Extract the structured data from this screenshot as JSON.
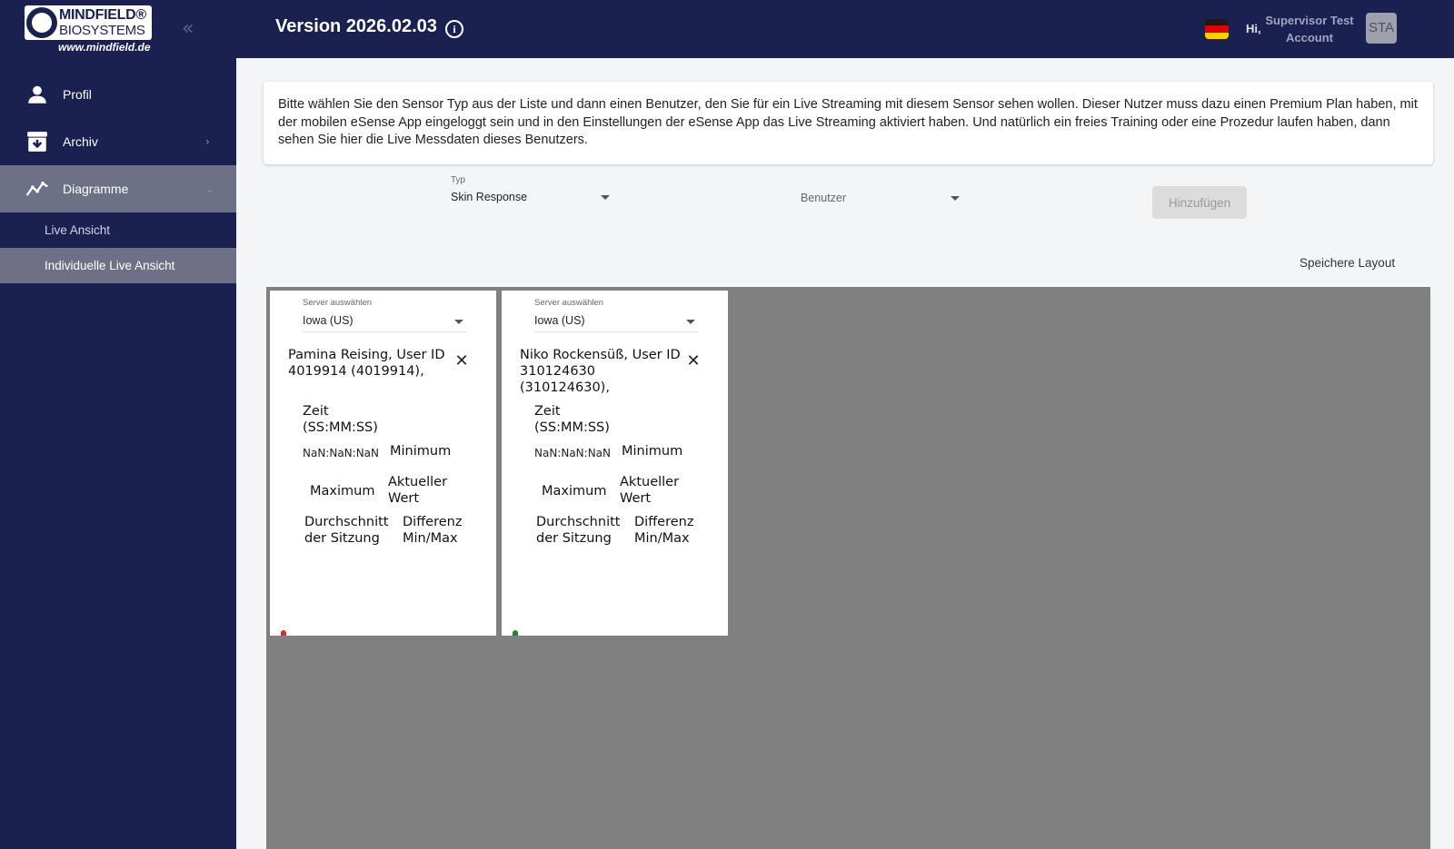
{
  "brand": {
    "line1": "MINDFIELD®",
    "line2": "BIOSYSTEMS",
    "url": "www.mindfield.de"
  },
  "sidebar": {
    "items": [
      {
        "label": "Profil",
        "icon": "person-icon"
      },
      {
        "label": "Archiv",
        "icon": "archive-icon"
      },
      {
        "label": "Diagramme",
        "icon": "chart-line-icon"
      }
    ],
    "sub_items": [
      {
        "label": "Live Ansicht"
      },
      {
        "label": "Individuelle Live Ansicht"
      }
    ]
  },
  "header": {
    "version": "Version 2026.02.03",
    "greeting": "Hi,",
    "user_line1": "Supervisor Test",
    "user_line2": "Account",
    "avatar_initials": "STA"
  },
  "notice": {
    "text": "Bitte wählen Sie den Sensor Typ aus der Liste und dann einen Benutzer, den Sie für ein Live Streaming mit diesem Sensor sehen wollen. Dieser Nutzer muss dazu einen Premium Plan haben, mit der mobilen eSense App eingeloggt sein und in den Einstellungen der eSense App das Live Streaming aktiviert haben. Und natürlich ein freies Training oder eine Prozedur laufen haben, dann sehen Sie hier die Live Messdaten dieses Benutzers."
  },
  "controls": {
    "typ_label": "Typ",
    "typ_value": "Skin Response",
    "benutzer_label": "Benutzer",
    "add_label": "Hinzufügen",
    "save_layout": "Speichere Layout"
  },
  "cards": [
    {
      "server_label": "Server auswählen",
      "server_value": "Iowa (US)",
      "user_title": "Pamina Reising, User ID 4019914 (4019914),",
      "zeit": "Zeit (SS:MM:SS)",
      "time_value": "NaN:NaN:NaN",
      "minimum": "Minimum",
      "maximum": "Maximum",
      "aktueller_wert": "Aktueller Wert",
      "durchschnitt": "Durchschnitt der Sitzung",
      "differenz": "Differenz Min/Max",
      "marker_color": "#d32f2f"
    },
    {
      "server_label": "Server auswählen",
      "server_value": "Iowa (US)",
      "user_title": "Niko Rockensüß, User ID 310124630 (310124630),",
      "zeit": "Zeit (SS:MM:SS)",
      "time_value": "NaN:NaN:NaN",
      "minimum": "Minimum",
      "maximum": "Maximum",
      "aktueller_wert": "Aktueller Wert",
      "durchschnitt": "Durchschnitt der Sitzung",
      "differenz": "Differenz Min/Max",
      "marker_color": "#2e7d32"
    }
  ],
  "colors": {
    "sidebar_bg": "#1a2150",
    "active_item_bg": "#6e7185",
    "grid_bg": "#808080"
  }
}
